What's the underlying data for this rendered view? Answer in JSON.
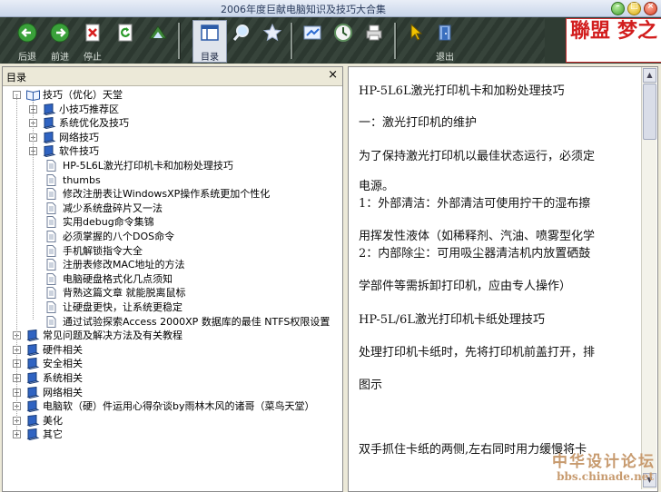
{
  "window": {
    "title": "2006年度巨献电脑知识及技巧大合集"
  },
  "toolbar": {
    "buttons": [
      {
        "label": "后退",
        "icon": "back-arrow-icon"
      },
      {
        "label": "前进",
        "icon": "forward-arrow-icon"
      },
      {
        "label": "停止",
        "icon": "stop-icon"
      },
      {
        "label": "",
        "icon": "refresh-icon"
      },
      {
        "label": "",
        "icon": "home-icon"
      },
      {
        "label": "目录",
        "icon": "contents-icon"
      },
      {
        "label": "",
        "icon": "search-icon"
      },
      {
        "label": "",
        "icon": "favorites-star-icon"
      },
      {
        "label": "",
        "icon": "locate-icon"
      },
      {
        "label": "",
        "icon": "history-icon"
      },
      {
        "label": "",
        "icon": "print-icon"
      },
      {
        "label": "",
        "icon": "pointer-icon"
      },
      {
        "label": "退出",
        "icon": "exit-icon"
      }
    ]
  },
  "logo": {
    "text1": "聯盟",
    "text2": "梦之"
  },
  "leftpane": {
    "title": "目录",
    "close": "×",
    "tree": [
      {
        "label": "技巧（优化）天堂",
        "type": "book-open",
        "level": 0,
        "exp": "-"
      },
      {
        "label": "小技巧推荐区",
        "type": "book",
        "level": 1,
        "exp": "+"
      },
      {
        "label": "系统优化及技巧",
        "type": "book",
        "level": 1,
        "exp": "+"
      },
      {
        "label": "网络技巧",
        "type": "book",
        "level": 1,
        "exp": "+"
      },
      {
        "label": "软件技巧",
        "type": "book",
        "level": 1,
        "exp": "+"
      },
      {
        "label": "HP-5L6L激光打印机卡和加粉处理技巧",
        "type": "page",
        "level": 1
      },
      {
        "label": "thumbs",
        "type": "page",
        "level": 1
      },
      {
        "label": "修改注册表让WindowsXP操作系统更加个性化",
        "type": "page",
        "level": 1
      },
      {
        "label": "减少系统盘碎片又一法",
        "type": "page",
        "level": 1
      },
      {
        "label": "实用debug命令集锦",
        "type": "page",
        "level": 1
      },
      {
        "label": "必须掌握的八个DOS命令",
        "type": "page",
        "level": 1
      },
      {
        "label": "手机解锁指令大全",
        "type": "page",
        "level": 1
      },
      {
        "label": "注册表修改MAC地址的方法",
        "type": "page",
        "level": 1
      },
      {
        "label": "电脑硬盘格式化几点须知",
        "type": "page",
        "level": 1
      },
      {
        "label": "背熟这篇文章 就能脱离鼠标",
        "type": "page",
        "level": 1
      },
      {
        "label": "让硬盘更快，让系统更稳定",
        "type": "page",
        "level": 1
      },
      {
        "label": "通过试验探索Access 2000XP 数据库的最佳 NTFS权限设置",
        "type": "page",
        "level": 1
      },
      {
        "label": "常见问题及解决方法及有关教程",
        "type": "book",
        "level": 0,
        "exp": "+"
      },
      {
        "label": "硬件相关",
        "type": "book",
        "level": 0,
        "exp": "+"
      },
      {
        "label": "安全相关",
        "type": "book",
        "level": 0,
        "exp": "+"
      },
      {
        "label": "系统相关",
        "type": "book",
        "level": 0,
        "exp": "+"
      },
      {
        "label": "网络相关",
        "type": "book",
        "level": 0,
        "exp": "+"
      },
      {
        "label": "电脑软（硬）件运用心得杂谈by雨林木风的诸哥（菜鸟天堂）",
        "type": "book",
        "level": 0,
        "exp": "+"
      },
      {
        "label": "美化",
        "type": "book",
        "level": 0,
        "exp": "+"
      },
      {
        "label": "其它",
        "type": "book",
        "level": 0,
        "exp": "+"
      }
    ]
  },
  "content": {
    "lines": [
      "HP-5L6L激光打印机卡和加粉处理技巧",
      "一：激光打印机的维护",
      "为了保持激光打印机以最佳状态运行，必须定",
      "电源。",
      "1：外部清洁：外部清洁可使用拧干的湿布擦",
      "用挥发性液体（如稀释剂、汽油、喷雾型化学",
      "2：内部除尘：可用吸尘器清洁机内放置硒鼓",
      "学部件等需拆卸打印机，应由专人操作）",
      "HP-5L/6L激光打印机卡纸处理技巧",
      "处理打印机卡纸时，先将打印机前盖打开，排",
      "图示",
      "双手抓住卡纸的两侧,左右同时用力缓慢将卡"
    ]
  },
  "watermark": {
    "line1": "中华设计论坛",
    "line2": "bbs.chinade.net"
  }
}
